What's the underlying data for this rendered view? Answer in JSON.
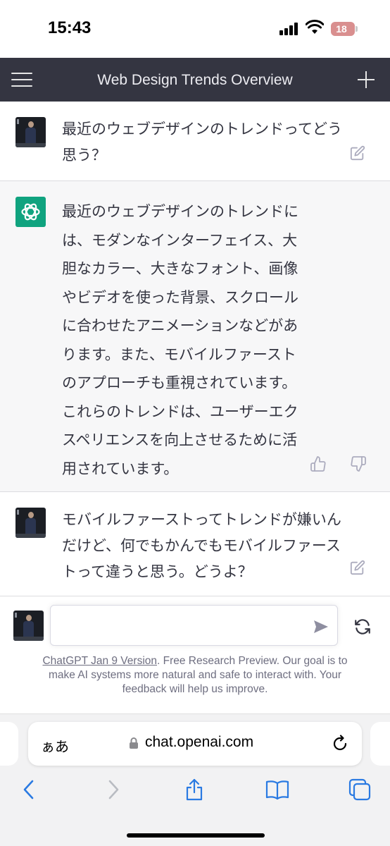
{
  "status_bar": {
    "time": "15:43",
    "battery": "18"
  },
  "header": {
    "title": "Web Design Trends Overview"
  },
  "messages": [
    {
      "role": "user",
      "lines": [
        "最近のウェブデザインのトレンドってどう",
        "思う？"
      ]
    },
    {
      "role": "assistant",
      "lines": [
        "最近のウェブデザインのトレンドに",
        "は、モダンなインターフェイス、大",
        "胆なカラー、大きなフォント、画像",
        "やビデオを使った背景、スクロール",
        "に合わせたアニメーションなどがあ",
        "ります。また、モバイルファースト",
        "のアプローチも重視されています。",
        "これらのトレンドは、ユーザーエク",
        "スペリエンスを向上させるために活",
        "用されています。"
      ]
    },
    {
      "role": "user",
      "lines": [
        "モバイルファーストってトレンドが嫌いん",
        "だけど、何でもかんでもモバイルファース",
        "トって違うと思う。どうよ？"
      ]
    }
  ],
  "composer": {
    "value": "",
    "placeholder": ""
  },
  "footer": {
    "version_link": "ChatGPT Jan 9 Version",
    "line1_rest": ". Free Research Preview. Our goal is to",
    "line2": "make AI systems more natural and safe to interact with. Your",
    "line3": "feedback will help us improve."
  },
  "browser": {
    "aa_label": "ぁあ",
    "url": "chat.openai.com"
  },
  "icons": {
    "menu": "menu-icon",
    "new_chat": "plus-icon",
    "edit": "edit-icon",
    "thumbs_up": "thumbs-up-icon",
    "thumbs_down": "thumbs-down-icon",
    "send": "send-icon",
    "regenerate": "regenerate-icon",
    "lock": "lock-icon",
    "reload": "reload-icon",
    "back": "chevron-left-icon",
    "forward": "chevron-right-icon",
    "share": "share-icon",
    "bookmarks": "book-icon",
    "tabs": "tabs-icon"
  },
  "colors": {
    "header_bg": "#343541",
    "assistant_bg": "#f7f7f8",
    "gpt_logo": "#10a37f",
    "safari_accent": "#2a7ae2"
  }
}
